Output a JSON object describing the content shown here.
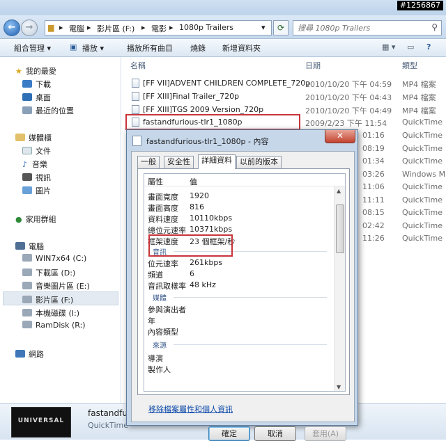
{
  "watermark": "#1256867",
  "nav": {
    "breadcrumb": [
      "電腦",
      "影片區 (F:)",
      "電影",
      "1080p Trailers"
    ],
    "search_placeholder": "搜尋 1080p Trailers"
  },
  "toolbar": {
    "organize": "組合管理 ▾",
    "play": "播放 ▾",
    "play_all": "播放所有曲目",
    "burn": "燒錄",
    "new_folder": "新增資料夾"
  },
  "sidebar": {
    "favorites": "我的最愛",
    "fav_items": [
      "下載",
      "桌面",
      "最近的位置"
    ],
    "libraries": "媒體櫃",
    "lib_items": [
      "文件",
      "音樂",
      "視訊",
      "圖片"
    ],
    "homegroup": "家用群組",
    "computer": "電腦",
    "drives": [
      "WIN7x64 (C:)",
      "下載區 (D:)",
      "音樂圖片區 (E:)",
      "影片區 (F:)",
      "本機磁碟 (I:)",
      "RamDisk (R:)"
    ],
    "network": "網路"
  },
  "columns": {
    "name": "名稱",
    "date": "日期",
    "type": "類型"
  },
  "files": [
    {
      "name": "[FF VII]ADVENT CHILDREN COMPLETE_720p",
      "date": "2010/10/20 下午 04:59",
      "type": "MP4 檔案"
    },
    {
      "name": "[FF XIII]Final Trailer_720p",
      "date": "2010/10/20 下午 04:43",
      "type": "MP4 檔案"
    },
    {
      "name": "[FF XIII]TGS 2009 Version_720p",
      "date": "2010/10/20 下午 04:49",
      "type": "MP4 檔案"
    },
    {
      "name": "fastandfurious-tlr1_1080p",
      "date": "2009/2/23 下午 11:54",
      "type": "QuickTime"
    }
  ],
  "hidden_rows": [
    {
      "date": "01:16",
      "type": "QuickTime"
    },
    {
      "date": "08:19",
      "type": "QuickTime"
    },
    {
      "date": "01:34",
      "type": "QuickTime"
    },
    {
      "date": "03:26",
      "type": "Windows M"
    },
    {
      "date": "11:06",
      "type": "QuickTime"
    },
    {
      "date": "11:11",
      "type": "QuickTime"
    },
    {
      "date": "08:15",
      "type": "QuickTime"
    },
    {
      "date": "02:42",
      "type": "QuickTime"
    },
    {
      "date": "11:26",
      "type": "QuickTime"
    }
  ],
  "status": {
    "name": "fastandfu",
    "type": "QuickTime",
    "thumb_text": "UNIVERSAL"
  },
  "dialog": {
    "title": "fastandfurious-tlr1_1080p - 內容",
    "tabs": [
      "一般",
      "安全性",
      "詳細資料",
      "以前的版本"
    ],
    "col_prop": "屬性",
    "col_val": "值",
    "video_rows": [
      {
        "k": "畫面寬度",
        "v": "1920"
      },
      {
        "k": "畫面高度",
        "v": "816"
      },
      {
        "k": "資料速度",
        "v": "10110kbps"
      },
      {
        "k": "總位元速率",
        "v": "10371kbps"
      },
      {
        "k": "框架速度",
        "v": "23 個框架/秒"
      }
    ],
    "audio_group": "音訊",
    "audio_rows": [
      {
        "k": "位元速率",
        "v": "261kbps"
      },
      {
        "k": "頻道",
        "v": "6"
      },
      {
        "k": "音訊取樣率",
        "v": "48 kHz"
      }
    ],
    "media_group": "媒體",
    "media_rows": [
      {
        "k": "參與演出者",
        "v": ""
      },
      {
        "k": "年",
        "v": ""
      },
      {
        "k": "內容類型",
        "v": ""
      }
    ],
    "origin_group": "來源",
    "origin_rows": [
      {
        "k": "導演",
        "v": ""
      },
      {
        "k": "製作人",
        "v": ""
      }
    ],
    "remove_link": "移除檔案屬性和個人資訊",
    "ok": "確定",
    "cancel": "取消",
    "apply": "套用(A)"
  }
}
